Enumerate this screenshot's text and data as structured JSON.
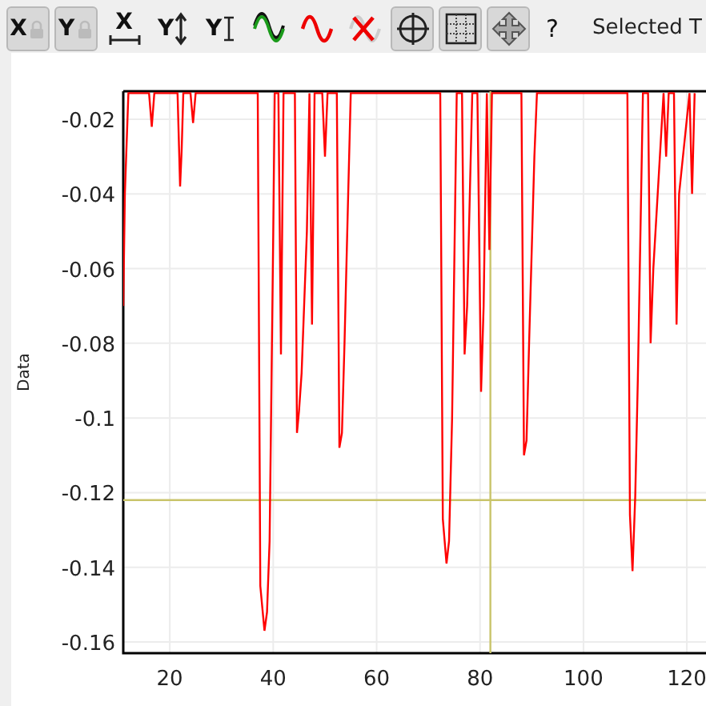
{
  "toolbar": {
    "buttons": [
      {
        "kind": "lock",
        "label": "X",
        "pressed": true
      },
      {
        "kind": "lock",
        "label": "Y",
        "pressed": true
      },
      {
        "kind": "hrange",
        "label": "X",
        "pressed": false
      },
      {
        "kind": "vrange",
        "label": "Y",
        "pressed": false
      },
      {
        "kind": "ibeam",
        "label": "Y",
        "pressed": false
      },
      {
        "kind": "wave-pair",
        "pressed": false
      },
      {
        "kind": "wave",
        "pressed": false
      },
      {
        "kind": "wave-delete",
        "pressed": false
      },
      {
        "kind": "crosshair",
        "pressed": true
      },
      {
        "kind": "grid",
        "pressed": true
      },
      {
        "kind": "move",
        "pressed": true
      },
      {
        "kind": "text",
        "label": "?",
        "pressed": false
      }
    ],
    "status": "Selected T"
  },
  "plot": {
    "chart_data": {
      "type": "line",
      "ylabel": "Data",
      "xlim": [
        11,
        123.7
      ],
      "ylim": [
        -0.163,
        -0.0125
      ],
      "grid": true,
      "xticks": [
        20,
        40,
        60,
        80,
        100,
        120
      ],
      "yticks": [
        -0.02,
        -0.04,
        -0.06,
        -0.08,
        -0.1,
        -0.12,
        -0.14,
        -0.16
      ],
      "x": [
        11,
        11.3,
        12,
        16,
        16.5,
        17,
        21.5,
        22,
        22.3,
        22.6,
        24,
        24.5,
        25,
        37,
        37.5,
        38.3,
        38.8,
        39.3,
        40,
        40.3,
        41,
        41.5,
        42,
        44.2,
        44.6,
        45,
        45.5,
        46.5,
        47,
        47.5,
        48,
        49.5,
        50,
        50.5,
        52.3,
        52.8,
        53.3,
        53.8,
        54.5,
        55,
        55.5,
        72.3,
        72.8,
        73.5,
        74,
        74.6,
        75.5,
        76.5,
        77,
        77.5,
        78.5,
        79.5,
        80.2,
        80.7,
        81.3,
        81.8,
        82.3,
        88,
        88.5,
        89,
        89.5,
        90.5,
        91,
        91.5,
        108.5,
        109,
        109.5,
        110,
        110.5,
        111.5,
        112.5,
        113,
        113.5,
        115.5,
        116,
        116.5,
        117.5,
        118,
        118.5,
        120.5,
        121,
        121.5
      ],
      "series": [
        {
          "color": "#ff0000",
          "values": [
            -0.07,
            -0.04,
            -0.013,
            -0.013,
            -0.022,
            -0.013,
            -0.013,
            -0.038,
            -0.028,
            -0.013,
            -0.013,
            -0.021,
            -0.013,
            -0.013,
            -0.145,
            -0.157,
            -0.152,
            -0.133,
            -0.05,
            -0.013,
            -0.013,
            -0.083,
            -0.013,
            -0.013,
            -0.104,
            -0.098,
            -0.088,
            -0.05,
            -0.013,
            -0.075,
            -0.013,
            -0.013,
            -0.03,
            -0.013,
            -0.013,
            -0.108,
            -0.104,
            -0.08,
            -0.04,
            -0.013,
            -0.013,
            -0.013,
            -0.127,
            -0.139,
            -0.133,
            -0.1,
            -0.013,
            -0.013,
            -0.083,
            -0.07,
            -0.013,
            -0.013,
            -0.093,
            -0.07,
            -0.013,
            -0.055,
            -0.013,
            -0.013,
            -0.11,
            -0.106,
            -0.08,
            -0.03,
            -0.013,
            -0.013,
            -0.013,
            -0.126,
            -0.141,
            -0.121,
            -0.09,
            -0.013,
            -0.013,
            -0.08,
            -0.06,
            -0.013,
            -0.03,
            -0.013,
            -0.013,
            -0.075,
            -0.04,
            -0.013,
            -0.04,
            -0.013
          ]
        }
      ],
      "ref_lines": [
        {
          "axis": "x",
          "value": 82
        },
        {
          "axis": "y",
          "value": -0.122
        }
      ]
    }
  }
}
